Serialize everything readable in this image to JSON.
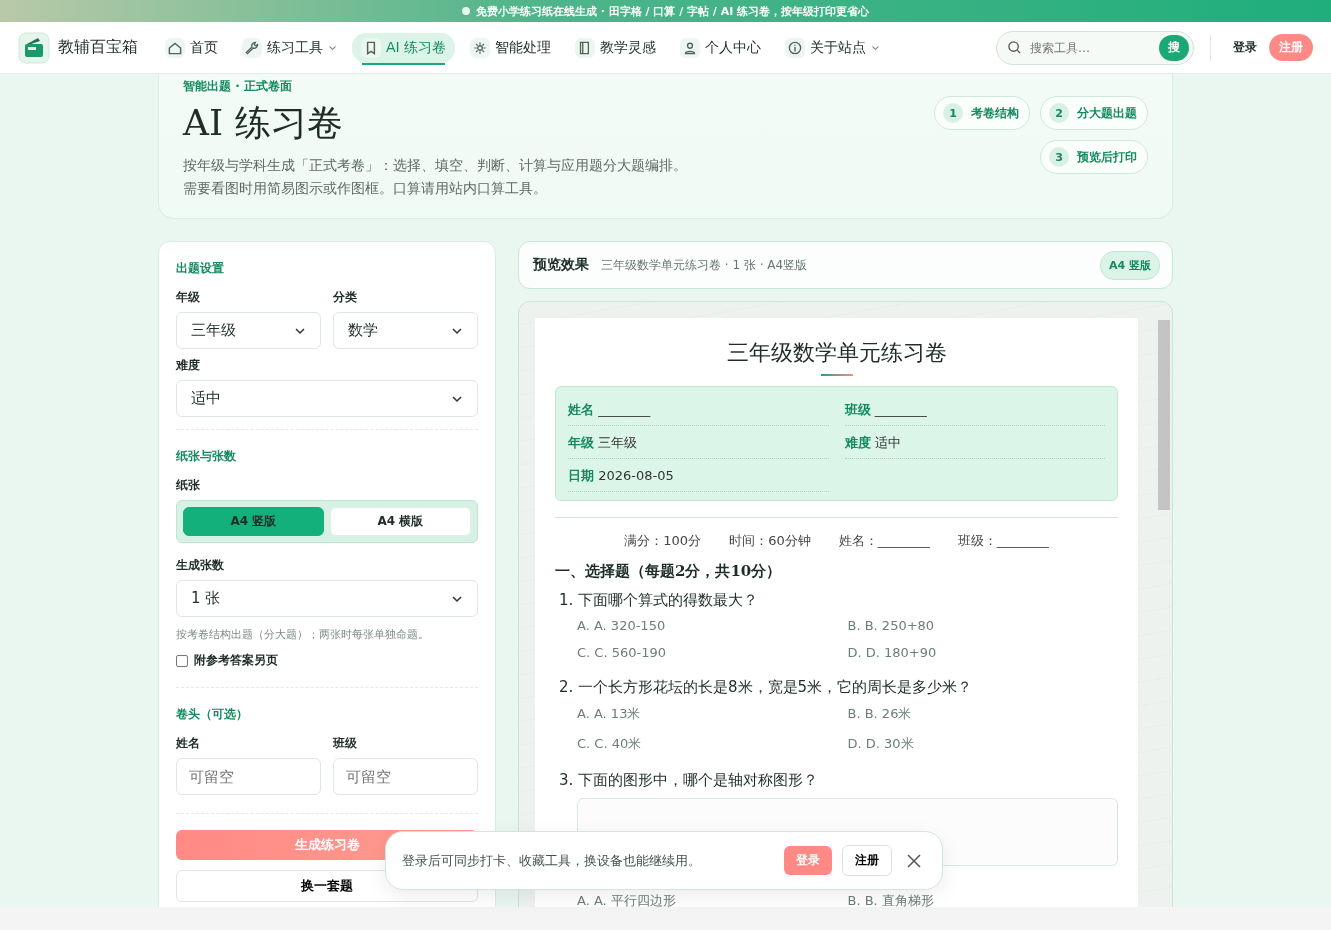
{
  "banner": {
    "text": "免费小学练习纸在线生成 · 田字格 / 口算 / 字帖 / AI 练习卷，按年级打印更省心"
  },
  "nav": {
    "logo": "教辅百宝箱",
    "items": [
      {
        "label": "首页",
        "caret": false,
        "selected": false
      },
      {
        "label": "练习工具",
        "caret": true,
        "selected": false
      },
      {
        "label": "AI 练习卷",
        "caret": false,
        "selected": true
      },
      {
        "label": "智能处理",
        "caret": false,
        "selected": false
      },
      {
        "label": "教学灵感",
        "caret": false,
        "selected": false
      },
      {
        "label": "个人中心",
        "caret": false,
        "selected": false
      },
      {
        "label": "关于站点",
        "caret": true,
        "selected": false
      }
    ],
    "search": {
      "placeholder": "搜索工具…",
      "button": "搜"
    },
    "login": "登录",
    "register": "注册"
  },
  "hero": {
    "eyebrow": "智能出题 · 正式卷面",
    "title": "AI 练习卷",
    "description": [
      "按年级与学科生成「正式考卷」：选择、填空、判断、计算与应用题分大题编排。",
      "需要看图时用简易图示或作图框。口算请用站内口算工具。"
    ],
    "steps": [
      {
        "number": "1",
        "label": "考卷结构"
      },
      {
        "number": "2",
        "label": "分大题出题"
      },
      {
        "number": "3",
        "label": "预览后打印"
      }
    ]
  },
  "settings": {
    "section_1": "出题设置",
    "grade": {
      "label": "年级",
      "value": "三年级"
    },
    "subject": {
      "label": "分类",
      "value": "数学"
    },
    "difficulty": {
      "label": "难度",
      "value": "适中"
    },
    "section_2": "纸张与张数",
    "paper": {
      "label": "纸张",
      "options": [
        {
          "label": "A4 竖版",
          "selected": true
        },
        {
          "label": "A4 横版",
          "selected": false
        }
      ]
    },
    "count": {
      "label": "生成张数",
      "value": "1 张"
    },
    "hint": "按考卷结构出题（分大题）；两张时每张单独命题。",
    "answer_sheet": {
      "label": "附参考答案另页",
      "checked": false
    },
    "section_3": "卷头（可选）",
    "name": {
      "label": "姓名",
      "placeholder": "可留空"
    },
    "class": {
      "label": "班级",
      "placeholder": "可留空"
    },
    "generate": "生成练习卷",
    "reroll": "换一套题"
  },
  "preview": {
    "title": "预览效果",
    "meta": "三年级数学单元练习卷 · 1 张 · A4竖版",
    "badge": "A4 竖版",
    "paper": {
      "title": "三年级数学单元练习卷",
      "info": [
        {
          "label": "姓名",
          "value": "________"
        },
        {
          "label": "班级",
          "value": "________"
        },
        {
          "label": "年级",
          "value": "三年级"
        },
        {
          "label": "难度",
          "value": "适中"
        },
        {
          "label": "日期",
          "value": "2026-08-05"
        }
      ],
      "score_line": [
        "满分：100分",
        "时间：60分钟",
        "姓名：________",
        "班级：________"
      ],
      "section": "一、选择题（每题2分，共10分）",
      "questions": [
        {
          "text": "1. 下面哪个算式的得数最大？",
          "figure": false,
          "options": [
            "A. A. 320-150",
            "B. B. 250+80",
            "C. C. 560-190",
            "D. D. 180+90"
          ]
        },
        {
          "text": "2. 一个长方形花坛的长是8米，宽是5米，它的周长是多少米？",
          "figure": false,
          "options": [
            "A. A. 13米",
            "B. B. 26米",
            "C. C. 40米",
            "D. D. 30米"
          ]
        },
        {
          "text": "3. 下面的图形中，哪个是轴对称图形？",
          "figure": true,
          "options": [
            "A. A. 平行四边形",
            "B. B. 直角梯形"
          ]
        }
      ]
    }
  },
  "toast": {
    "text": "登录后可同步打卡、收藏工具，换设备也能继续用。",
    "login": "登录",
    "register": "注册"
  }
}
